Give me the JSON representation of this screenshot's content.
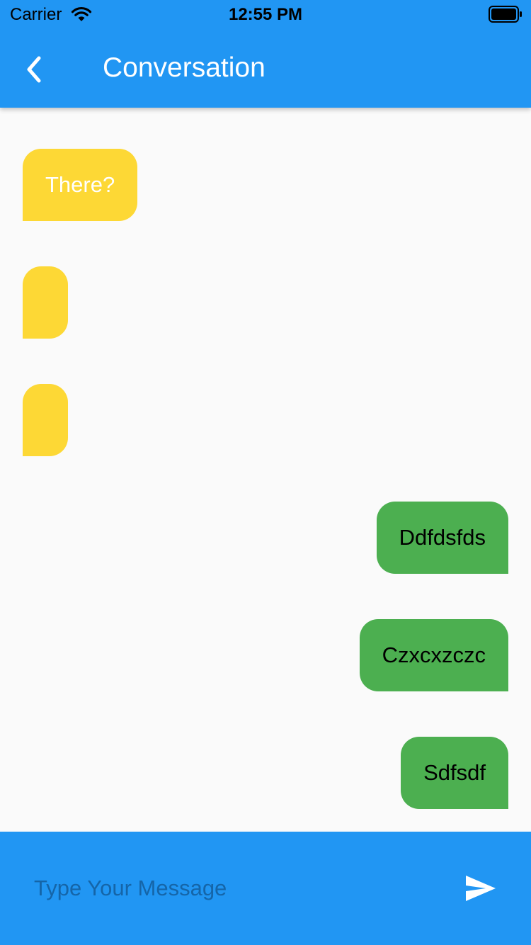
{
  "status_bar": {
    "carrier": "Carrier",
    "time": "12:55 PM"
  },
  "app_bar": {
    "title": "Conversation",
    "back_icon": "chevron-left-icon"
  },
  "messages": [
    {
      "text": "There?",
      "direction": "received"
    },
    {
      "text": "",
      "direction": "received"
    },
    {
      "text": "",
      "direction": "received"
    },
    {
      "text": "Ddfdsfds",
      "direction": "sent"
    },
    {
      "text": "Czxcxzczc",
      "direction": "sent"
    },
    {
      "text": "Sdfsdf",
      "direction": "sent"
    }
  ],
  "composer": {
    "placeholder": "Type Your Message",
    "value": "",
    "send_icon": "send-icon"
  },
  "colors": {
    "primary": "#2196f3",
    "received_bubble": "#fdd835",
    "sent_bubble": "#4caf50",
    "background": "#fafafa"
  }
}
